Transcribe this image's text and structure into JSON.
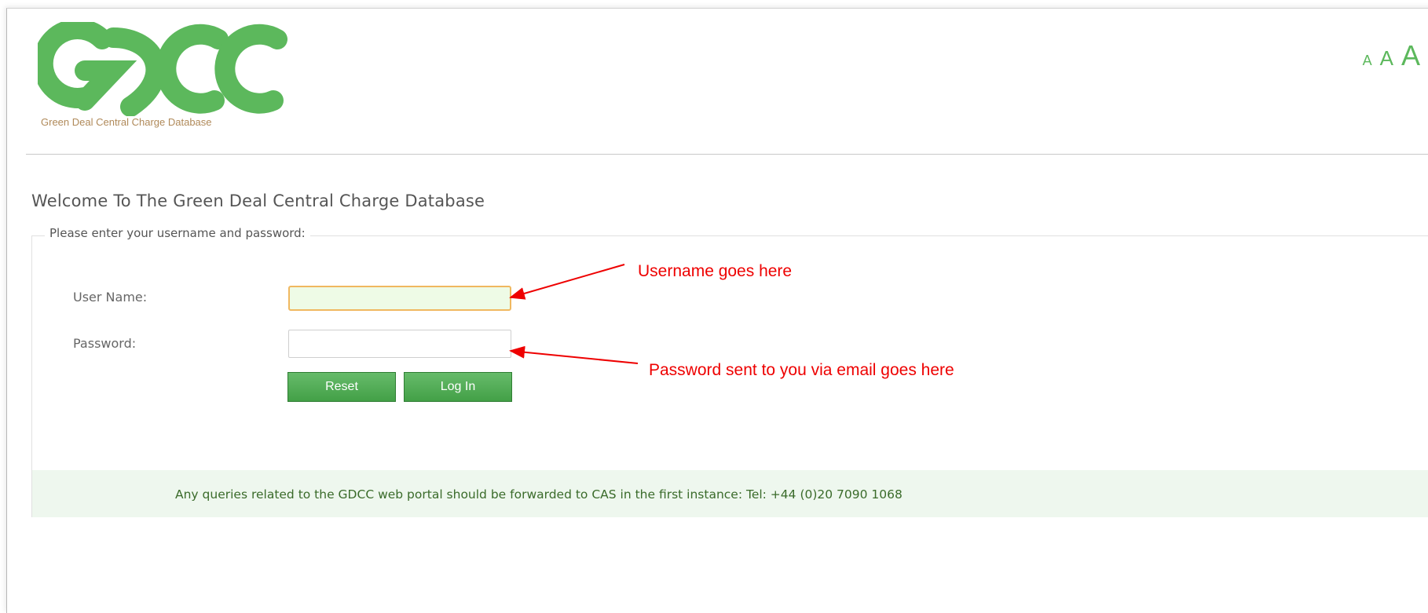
{
  "logo": {
    "icon": "gdcc-logo",
    "brand_color": "#5cb85c",
    "tagline": "Green Deal Central Charge Database"
  },
  "font_sizer": {
    "small": "A",
    "medium": "A",
    "large": "A"
  },
  "page": {
    "welcome_title": "Welcome To The Green Deal Central Charge Database"
  },
  "login": {
    "legend": "Please enter your username and password:",
    "username_label": "User Name:",
    "password_label": "Password:",
    "username_value": "",
    "password_value": "",
    "reset_label": "Reset",
    "login_label": "Log In"
  },
  "footer": {
    "text": "Any queries related to the GDCC web portal should be forwarded to CAS in the first instance: Tel: +44 (0)20 7090 1068"
  },
  "annotations": {
    "username_note": "Username goes here",
    "password_note": "Password sent to you via email goes here",
    "color": "#ee0000"
  }
}
